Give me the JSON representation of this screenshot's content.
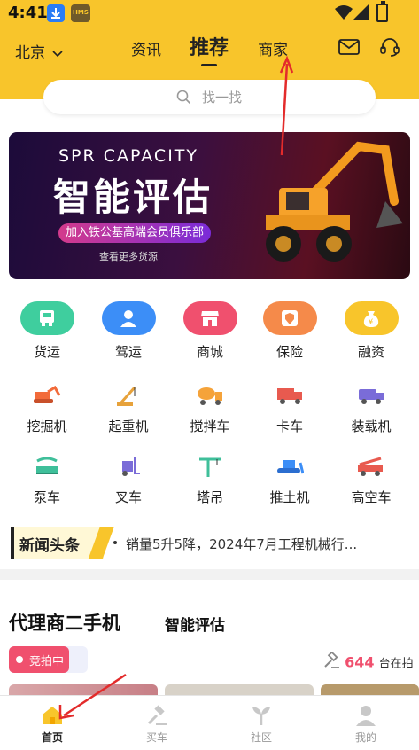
{
  "status_bar": {
    "time": "4:41",
    "hms_badge": "HMS"
  },
  "header": {
    "city": "北京",
    "tabs": [
      {
        "label": "资讯",
        "active": false
      },
      {
        "label": "推荐",
        "active": true
      },
      {
        "label": "商家",
        "active": false
      }
    ],
    "icons": [
      "mail-icon",
      "customer-service-icon"
    ],
    "search_placeholder": "找一找",
    "accent_color": "#f8c52b"
  },
  "banner": {
    "top_text": "SPR CAPACITY",
    "title": "智能评估",
    "pill_text": "加入铁公基高端会员俱乐部",
    "more_text": "查看更多货源"
  },
  "services": [
    {
      "label": "货运",
      "icon": "truck-front-icon",
      "color": "#3fce9e"
    },
    {
      "label": "驾运",
      "icon": "driver-icon",
      "color": "#3c8ef7"
    },
    {
      "label": "商城",
      "icon": "shop-icon",
      "color": "#f0506e"
    },
    {
      "label": "保险",
      "icon": "insurance-icon",
      "color": "#f58a4a"
    },
    {
      "label": "融资",
      "icon": "money-bag-icon",
      "color": "#f8c52b"
    }
  ],
  "categories": [
    {
      "label": "挖掘机",
      "icon": "excavator-icon",
      "color": "#f26b3a"
    },
    {
      "label": "起重机",
      "icon": "crane-icon",
      "color": "#e7a23b"
    },
    {
      "label": "搅拌车",
      "icon": "mixer-truck-icon",
      "color": "#f5a33a"
    },
    {
      "label": "卡车",
      "icon": "truck-icon",
      "color": "#e85a4f"
    },
    {
      "label": "装载机",
      "icon": "loader-icon",
      "color": "#7a6cd8"
    },
    {
      "label": "泵车",
      "icon": "pump-truck-icon",
      "color": "#3fbf9a"
    },
    {
      "label": "叉车",
      "icon": "forklift-icon",
      "color": "#7a6cd8"
    },
    {
      "label": "塔吊",
      "icon": "tower-crane-icon",
      "color": "#3fbf9a"
    },
    {
      "label": "推土机",
      "icon": "bulldozer-icon",
      "color": "#3c8ef7"
    },
    {
      "label": "高空车",
      "icon": "aerial-truck-icon",
      "color": "#e85a4f"
    }
  ],
  "news": {
    "logo_text": "新闻头条",
    "headline": "销量5升5降，2024年7月工程机械行..."
  },
  "section": {
    "title": "代理商二手机",
    "tab": "智能评估",
    "auction_badge": "竞拍中",
    "auction_count": "644",
    "auction_suffix": "台在拍"
  },
  "tabbar": [
    {
      "label": "首页",
      "icon": "home-icon",
      "active": true
    },
    {
      "label": "买车",
      "icon": "gavel-icon",
      "active": false
    },
    {
      "label": "社区",
      "icon": "sprout-icon",
      "active": false
    },
    {
      "label": "我的",
      "icon": "profile-icon",
      "active": false
    }
  ]
}
